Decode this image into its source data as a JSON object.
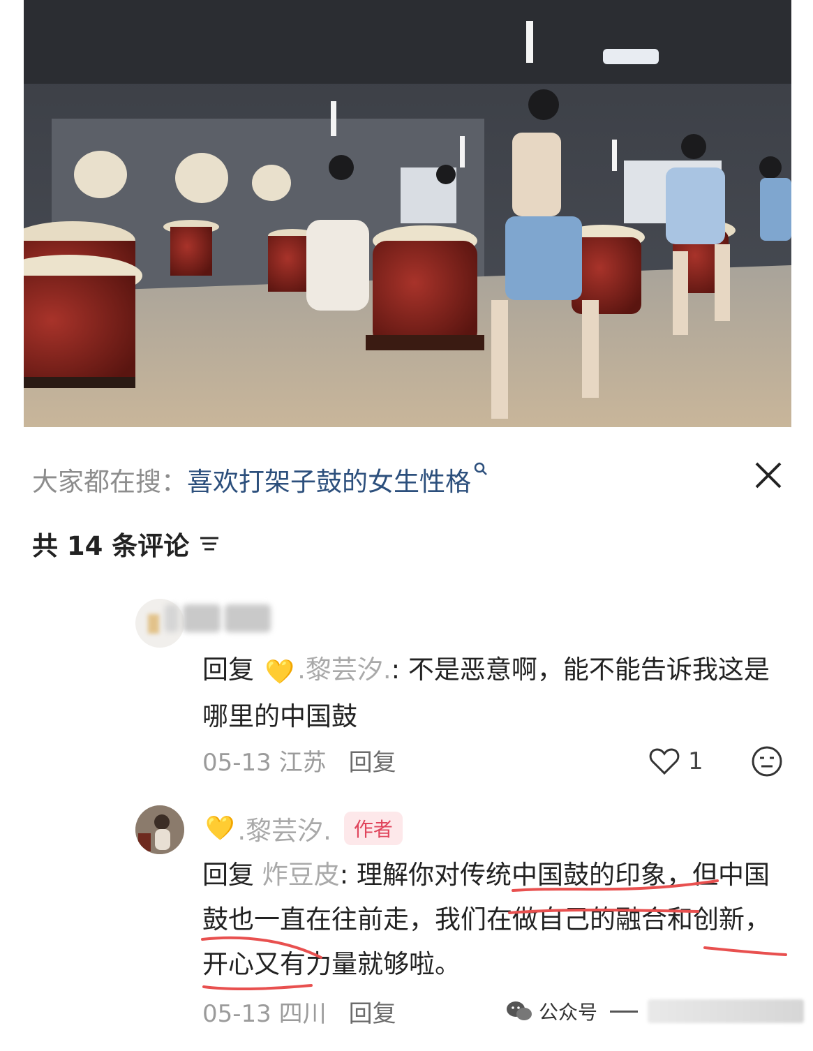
{
  "search": {
    "prefix": "大家都在搜：",
    "term": "喜欢打架子鼓的女生性格",
    "mag_icon": "search-icon"
  },
  "comments_header": {
    "title": "共 14 条评论",
    "sort_icon": "sort-icon"
  },
  "comment1": {
    "reply_word": "回复",
    "mention": ".黎芸汐.",
    "text": ": 不是恶意啊，能不能告诉我这是哪里的中国鼓",
    "date": "05-13 江苏",
    "reply_label": "回复",
    "likes": "1"
  },
  "comment2": {
    "author_name": ".黎芸汐.",
    "author_badge": "作者",
    "reply_word": "回复",
    "mention": "炸豆皮",
    "text": ": 理解你对传统中国鼓的印象，但中国鼓也一直在往前走，我们在做自己的融合和创新，开心又有力量就够啦。",
    "date": "05-13 四川",
    "reply_label": "回复"
  },
  "watermark": {
    "label": "公众号"
  },
  "colors": {
    "link_blue": "#2c4f7c",
    "badge_bg": "#fde8ea",
    "badge_text": "#e0455c",
    "underline_red": "#e8504f",
    "heart_yellow": "#f5c228"
  }
}
